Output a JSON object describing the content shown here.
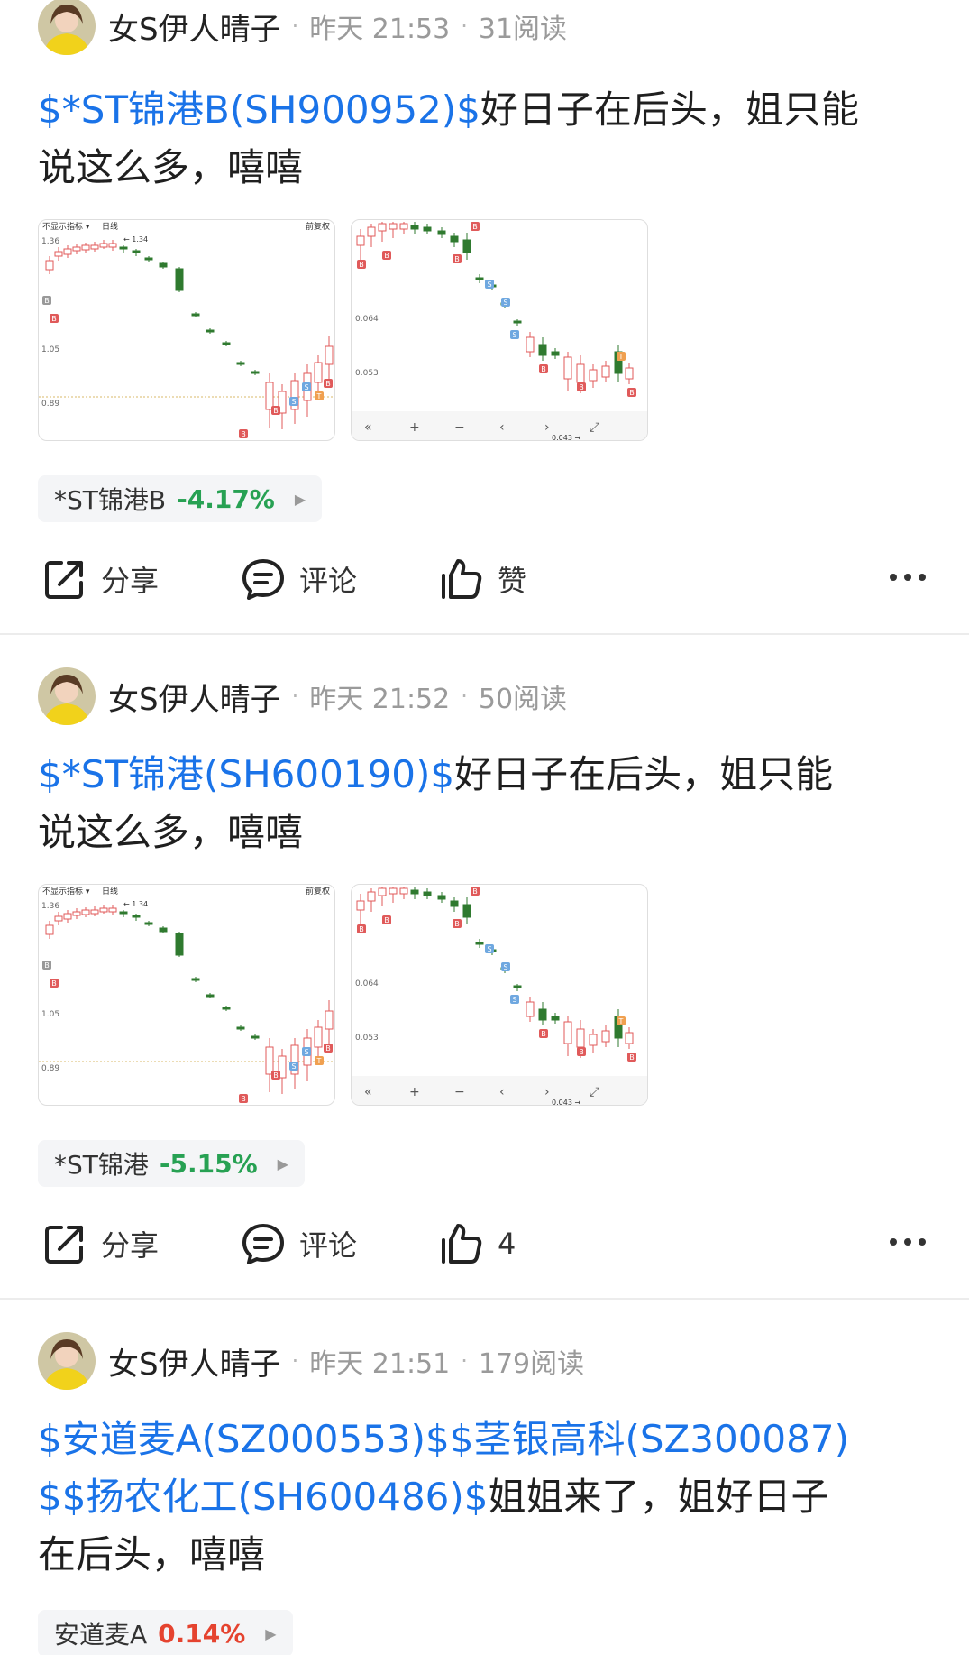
{
  "posts": [
    {
      "author": "女S伊人晴子",
      "time": "昨天 21:53",
      "reads": "31阅读",
      "links": [
        "$*ST锦港B(SH900952)$"
      ],
      "text_line1": "好日子在后头，姐只能",
      "text_line2": "说这么多，嘻嘻",
      "tag": {
        "name": "*ST锦港B",
        "change": "-4.17%",
        "direction": "down"
      },
      "actions": {
        "share": "分享",
        "comment": "评论",
        "like": "赞"
      },
      "chart1": {
        "indicator": "不显示指标",
        "period": "日线",
        "adjust": "前复权",
        "ticks": [
          "1.36",
          "1.05",
          "0.89"
        ],
        "marker": "1.34"
      },
      "chart2": {
        "ticks": [
          "0.064",
          "0.053"
        ],
        "marker": "0.043"
      }
    },
    {
      "author": "女S伊人晴子",
      "time": "昨天 21:52",
      "reads": "50阅读",
      "links": [
        "$*ST锦港(SH600190)$"
      ],
      "text_line1": "好日子在后头，姐只能",
      "text_line2": "说这么多，嘻嘻",
      "tag": {
        "name": "*ST锦港",
        "change": "-5.15%",
        "direction": "down"
      },
      "actions": {
        "share": "分享",
        "comment": "评论",
        "like": "4"
      },
      "chart1": {
        "indicator": "不显示指标",
        "period": "日线",
        "adjust": "前复权",
        "ticks": [
          "1.36",
          "1.05",
          "0.89"
        ],
        "marker": "1.34"
      },
      "chart2": {
        "ticks": [
          "0.064",
          "0.053"
        ],
        "marker": "0.043"
      }
    },
    {
      "author": "女S伊人晴子",
      "time": "昨天 21:51",
      "reads": "179阅读",
      "links": [
        "$安道麦A(SZ000553)$",
        "$茎银高科(SZ300087)",
        "$$扬农化工(SH600486)$"
      ],
      "text_line1": "姐姐来了，姐好日子",
      "text_line2": "在后头，嘻嘻",
      "tag": {
        "name": "安道麦A",
        "change": "0.14%",
        "direction": "up"
      }
    }
  ],
  "colors": {
    "link": "#1a73e8",
    "down": "#27a153",
    "up": "#e5432f",
    "candle_up": "#e05a5a",
    "candle_down": "#2f7a2f",
    "sell_marker": "#6fa8e0",
    "t_marker": "#f0a050"
  },
  "icons": {
    "share": "share-icon",
    "comment": "comment-icon",
    "like": "thumbs-up-icon",
    "more": "more-icon"
  }
}
